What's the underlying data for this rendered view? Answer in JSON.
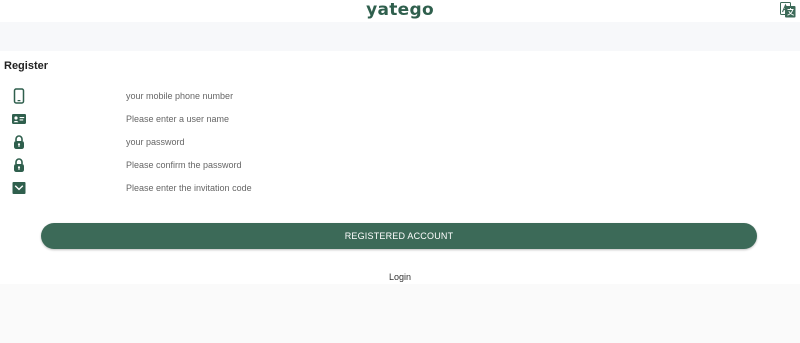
{
  "header": {
    "logo": "yatego",
    "language_icon": "translate-icon"
  },
  "page": {
    "title": "Register"
  },
  "form": {
    "fields": [
      {
        "name": "phone",
        "icon": "mobile-phone-icon",
        "placeholder": "your mobile phone number"
      },
      {
        "name": "username",
        "icon": "id-card-icon",
        "placeholder": "Please enter a user name"
      },
      {
        "name": "password",
        "icon": "lock-icon",
        "placeholder": "your password"
      },
      {
        "name": "confirm_password",
        "icon": "lock-icon",
        "placeholder": "Please confirm the password"
      },
      {
        "name": "invitation_code",
        "icon": "envelope-icon",
        "placeholder": "Please enter the invitation code"
      }
    ],
    "submit_label": "REGISTERED ACCOUNT",
    "login_label": "Login"
  },
  "colors": {
    "brand": "#2f5f4d",
    "button": "#3c6a58",
    "band": "#f7f8fa"
  }
}
